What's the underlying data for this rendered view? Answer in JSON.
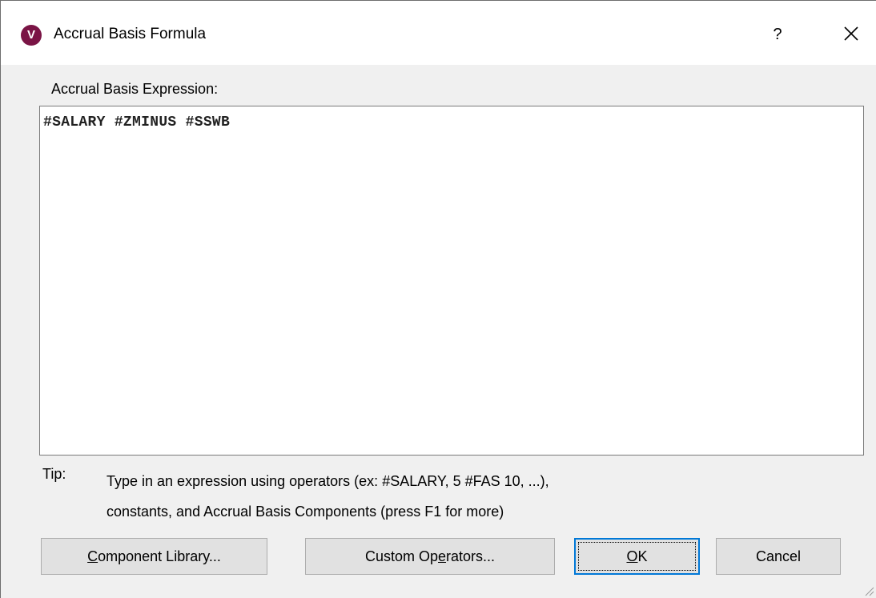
{
  "window": {
    "title": "Accrual Basis Formula",
    "app_icon_letter": "V",
    "help_label": "?",
    "accent_color": "#7a1445"
  },
  "expression": {
    "label": "Accrual Basis Expression:",
    "value": "#SALARY #ZMINUS #SSWB"
  },
  "tip": {
    "label": "Tip:",
    "line1": "Type in an expression using operators (ex: #SALARY, 5 #FAS 10, ...),",
    "line2": "constants, and Accrual Basis Components (press F1 for more)"
  },
  "buttons": {
    "component_library": {
      "mnemonic": "C",
      "rest": "omponent Library..."
    },
    "custom_operators": {
      "before": "Custom Op",
      "mnemonic": "e",
      "after": "rators..."
    },
    "ok": {
      "mnemonic": "O",
      "rest": "K"
    },
    "cancel": "Cancel"
  }
}
